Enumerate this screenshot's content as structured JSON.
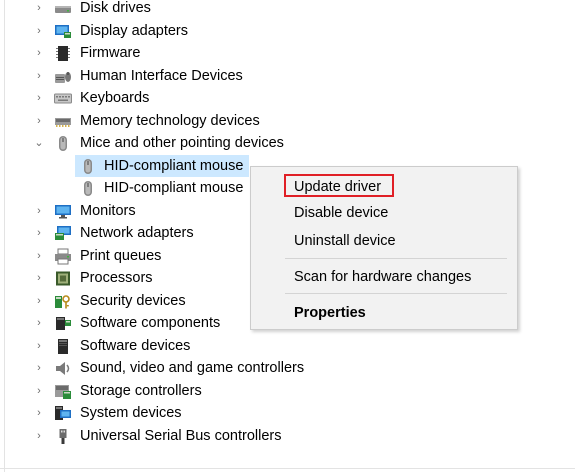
{
  "tree": {
    "categories": [
      {
        "label": "Disk drives",
        "icon": "disk-drive-icon",
        "expanded": false
      },
      {
        "label": "Display adapters",
        "icon": "display-adapter-icon",
        "expanded": false
      },
      {
        "label": "Firmware",
        "icon": "firmware-icon",
        "expanded": false
      },
      {
        "label": "Human Interface Devices",
        "icon": "hid-icon",
        "expanded": false
      },
      {
        "label": "Keyboards",
        "icon": "keyboard-icon",
        "expanded": false
      },
      {
        "label": "Memory technology devices",
        "icon": "memory-device-icon",
        "expanded": false
      },
      {
        "label": "Mice and other pointing devices",
        "icon": "mouse-icon",
        "expanded": true
      },
      {
        "label": "Monitors",
        "icon": "monitor-icon",
        "expanded": false
      },
      {
        "label": "Network adapters",
        "icon": "network-adapter-icon",
        "expanded": false
      },
      {
        "label": "Print queues",
        "icon": "printer-icon",
        "expanded": false
      },
      {
        "label": "Processors",
        "icon": "processor-icon",
        "expanded": false
      },
      {
        "label": "Security devices",
        "icon": "security-device-icon",
        "expanded": false
      },
      {
        "label": "Software components",
        "icon": "software-component-icon",
        "expanded": false
      },
      {
        "label": "Software devices",
        "icon": "software-device-icon",
        "expanded": false
      },
      {
        "label": "Sound, video and game controllers",
        "icon": "sound-icon",
        "expanded": false
      },
      {
        "label": "Storage controllers",
        "icon": "storage-controller-icon",
        "expanded": false
      },
      {
        "label": "System devices",
        "icon": "system-device-icon",
        "expanded": false
      },
      {
        "label": "Universal Serial Bus controllers",
        "icon": "usb-icon",
        "expanded": false
      }
    ],
    "mice_children": [
      {
        "label": "HID-compliant mouse",
        "icon": "mouse-icon",
        "selected": true
      },
      {
        "label": "HID-compliant mouse",
        "icon": "mouse-icon",
        "selected": false
      }
    ]
  },
  "context_menu": {
    "update_driver": "Update driver",
    "disable_device": "Disable device",
    "uninstall_device": "Uninstall device",
    "scan_hardware": "Scan for hardware changes",
    "properties": "Properties"
  },
  "colors": {
    "selection": "#cce8ff",
    "menu_background": "#f2f2f2",
    "highlight_border": "#e01f26"
  }
}
